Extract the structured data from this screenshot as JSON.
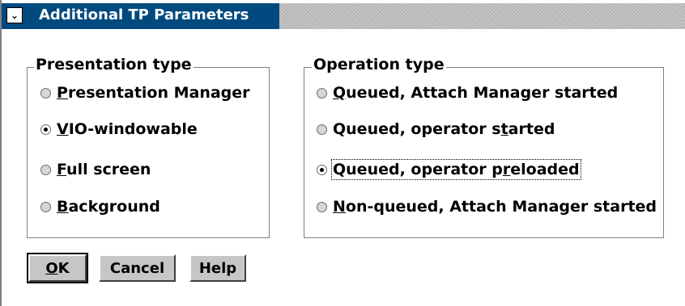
{
  "window": {
    "title": "Additional TP Parameters",
    "system_menu_glyph": "⌄"
  },
  "presentation_type": {
    "label": "Presentation type",
    "options": [
      {
        "mnemonic": "P",
        "rest": "resentation Manager",
        "checked": false
      },
      {
        "mnemonic": "V",
        "rest": "IO-windowable",
        "checked": true
      },
      {
        "mnemonic": "F",
        "rest": "ull screen",
        "checked": false
      },
      {
        "mnemonic": "B",
        "rest": "ackground",
        "checked": false
      }
    ]
  },
  "operation_type": {
    "label": "Operation type",
    "options": [
      {
        "pre": "",
        "mnemonic": "Q",
        "post": "ueued, Attach Manager started",
        "checked": false
      },
      {
        "pre": "Queued, operator s",
        "mnemonic": "t",
        "post": "arted",
        "checked": false
      },
      {
        "pre": "Queued, operator p",
        "mnemonic": "r",
        "post": "eloaded",
        "checked": true,
        "focused": true
      },
      {
        "pre": "",
        "mnemonic": "N",
        "post": "on-queued, Attach Manager started",
        "checked": false
      }
    ]
  },
  "buttons": {
    "ok": {
      "mnemonic": "O",
      "rest": "K"
    },
    "cancel": "Cancel",
    "help": "Help"
  },
  "colors": {
    "title_active": "#004a7f",
    "title_inactive": "#c8c8c8",
    "button_face": "#c6c6c6",
    "frame_line": "#808080"
  }
}
